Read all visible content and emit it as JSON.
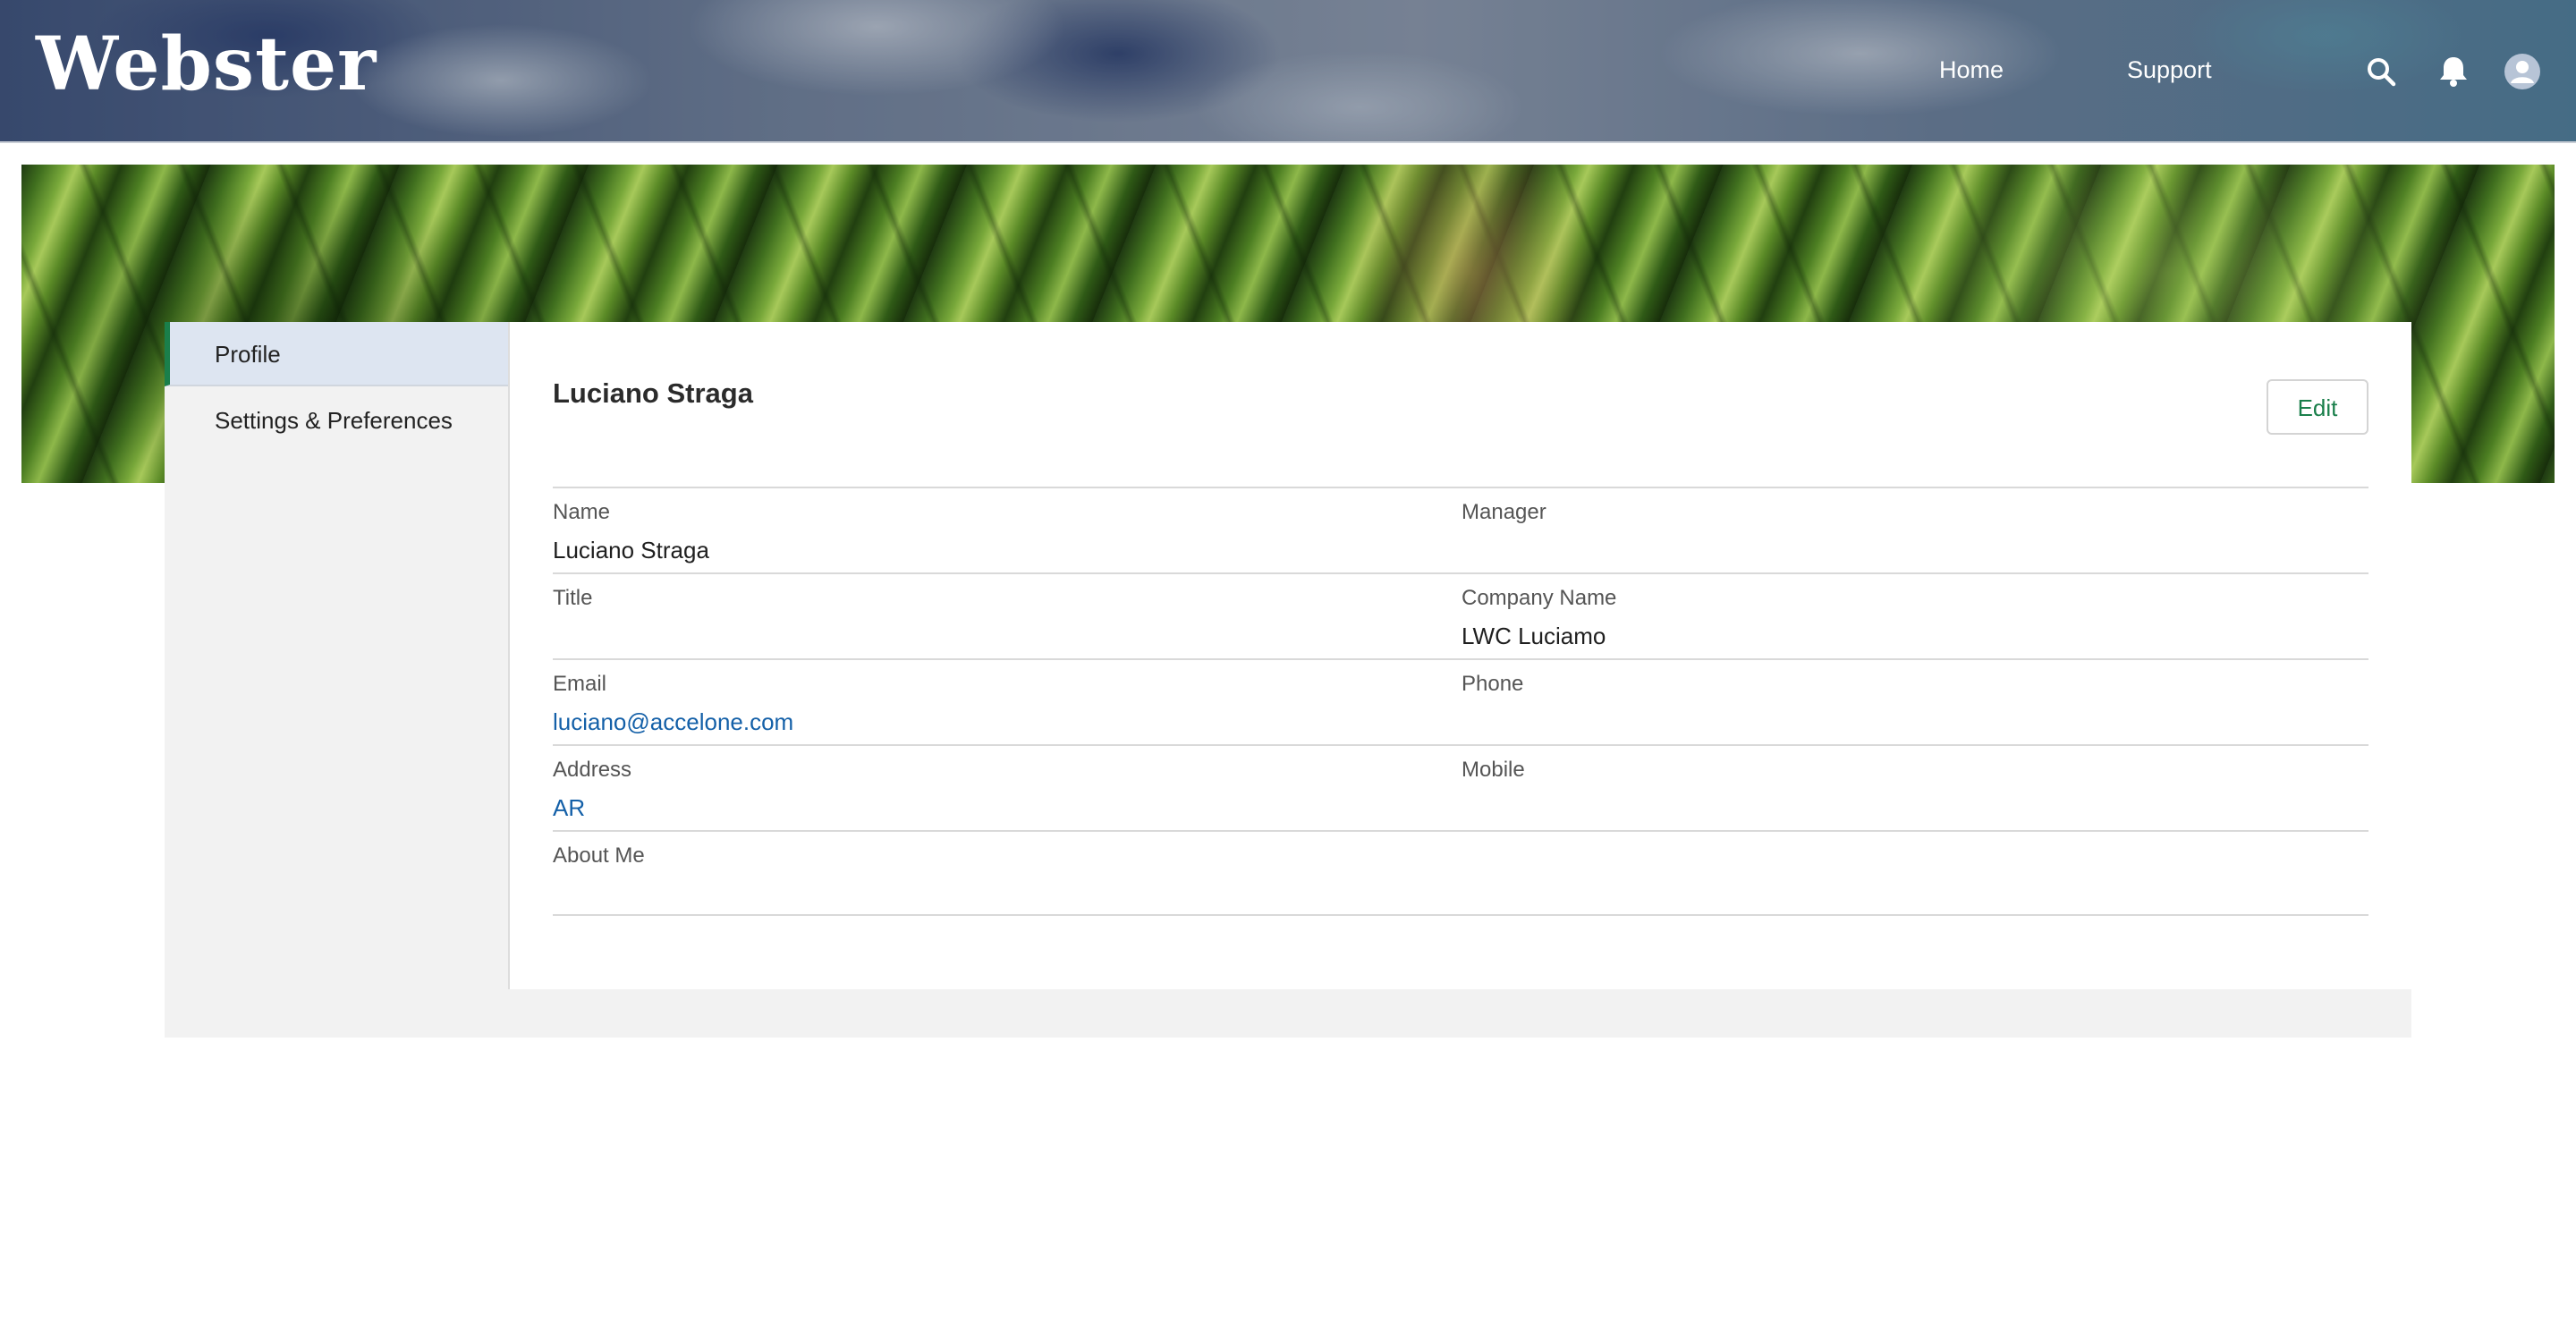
{
  "header": {
    "logo": "Webster",
    "nav": [
      {
        "label": "Home"
      },
      {
        "label": "Support"
      }
    ],
    "icons": [
      "search-icon",
      "bell-icon",
      "avatar-icon"
    ]
  },
  "sidebar": {
    "items": [
      {
        "label": "Profile",
        "active": true
      },
      {
        "label": "Settings & Preferences",
        "active": false
      }
    ]
  },
  "profile": {
    "name": "Luciano Straga",
    "edit_label": "Edit",
    "fields": {
      "name": {
        "label": "Name",
        "value": "Luciano Straga"
      },
      "manager": {
        "label": "Manager",
        "value": ""
      },
      "title": {
        "label": "Title",
        "value": ""
      },
      "company": {
        "label": "Company Name",
        "value": "LWC Luciamo"
      },
      "email": {
        "label": "Email",
        "value": "luciano@accelone.com"
      },
      "phone": {
        "label": "Phone",
        "value": ""
      },
      "address": {
        "label": "Address",
        "value": "AR"
      },
      "mobile": {
        "label": "Mobile",
        "value": ""
      },
      "about": {
        "label": "About Me",
        "value": ""
      }
    }
  },
  "colors": {
    "accent_green": "#1a7f4b",
    "link_blue": "#1460a8",
    "active_tab_bg": "#dde5f1"
  }
}
